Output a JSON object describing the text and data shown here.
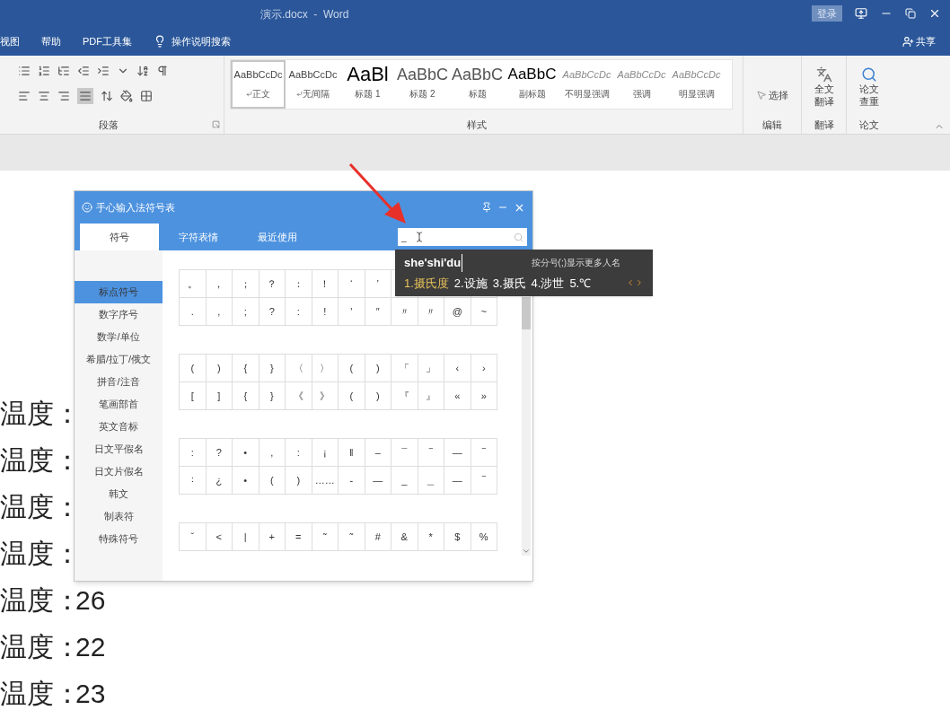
{
  "title_bar": {
    "title": "演示.docx  -  Word",
    "login": "登录"
  },
  "menu": [
    {
      "label": "视图",
      "kind": "tab"
    },
    {
      "label": "帮助",
      "kind": "tab"
    },
    {
      "label": "PDF工具集",
      "kind": "tab"
    },
    {
      "label": "操作说明搜索",
      "kind": "search"
    }
  ],
  "share": "共享",
  "ribbon": {
    "paragraph_group": "段落",
    "styles_group": "样式",
    "styles": [
      {
        "preview": "AaBbCcDc",
        "name": "正文",
        "selected": true,
        "kind": "plain"
      },
      {
        "preview": "AaBbCcDc",
        "name": "无间隔",
        "selected": false,
        "kind": "plain"
      },
      {
        "preview": "AaBl",
        "name": "标题 1",
        "selected": false,
        "kind": "heading1"
      },
      {
        "preview": "AaBbC",
        "name": "标题 2",
        "selected": false,
        "kind": "heading2"
      },
      {
        "preview": "AaBbC",
        "name": "标题",
        "selected": false,
        "kind": "heading2"
      },
      {
        "preview": "AaBbC",
        "name": "副标题",
        "selected": false,
        "kind": "subtitle"
      },
      {
        "preview": "AaBbCcDc",
        "name": "不明显强调",
        "selected": false,
        "kind": "emphasis"
      },
      {
        "preview": "AaBbCcDc",
        "name": "强调",
        "selected": false,
        "kind": "emphasis"
      },
      {
        "preview": "AaBbCcDc",
        "name": "明显强调",
        "selected": false,
        "kind": "emphasis"
      }
    ],
    "edit": {
      "select": "选择",
      "group": "编辑"
    },
    "translate": {
      "label": "全文翻译",
      "group": "翻译"
    },
    "paper": {
      "label": "论文查重",
      "group": "论文"
    }
  },
  "document": {
    "lines": [
      {
        "label": "温度："
      },
      {
        "label": "温度："
      },
      {
        "label": "温度："
      },
      {
        "label": "温度："
      },
      {
        "label": "温度：",
        "value": "26"
      },
      {
        "label": "温度：",
        "value": "22"
      },
      {
        "label": "温度：",
        "value": "23"
      }
    ]
  },
  "symbol_dialog": {
    "title": "手心输入法符号表",
    "tabs": [
      {
        "label": "符号",
        "selected": true
      },
      {
        "label": "字符表情",
        "selected": false
      },
      {
        "label": "最近使用",
        "selected": false
      }
    ],
    "search": {
      "value": "_"
    },
    "categories": [
      {
        "label": "标点符号",
        "selected": true
      },
      {
        "label": "数字序号",
        "selected": false
      },
      {
        "label": "数学/单位",
        "selected": false
      },
      {
        "label": "希腊/拉丁/俄文",
        "selected": false
      },
      {
        "label": "拼音/注音",
        "selected": false
      },
      {
        "label": "笔画部首",
        "selected": false
      },
      {
        "label": "英文音标",
        "selected": false
      },
      {
        "label": "日文平假名",
        "selected": false
      },
      {
        "label": "日文片假名",
        "selected": false
      },
      {
        "label": "韩文",
        "selected": false
      },
      {
        "label": "制表符",
        "selected": false
      },
      {
        "label": "特殊符号",
        "selected": false
      }
    ],
    "blocks": [
      [
        [
          "。",
          "，",
          "；",
          "？",
          "：",
          "！",
          "‘",
          "’"
        ],
        [
          ".",
          ",",
          ";",
          "?",
          ":",
          "!",
          "'",
          "″",
          "〃",
          "〃",
          "@",
          "~"
        ]
      ],
      [
        [
          "(",
          ")",
          "{",
          "}",
          "〈",
          "〉",
          "(",
          ")",
          "「",
          "」",
          "‹",
          "›"
        ],
        [
          "[",
          "]",
          "{",
          "}",
          "《",
          "》",
          "(",
          ")",
          "『",
          "』",
          "«",
          "»"
        ]
      ],
      [
        [
          ":",
          "?",
          "•",
          ",",
          ":",
          "¡",
          "‖",
          "–",
          "¯",
          "‾",
          "—",
          "‾"
        ],
        [
          "∶",
          "¿",
          "•",
          "(",
          ")",
          "……",
          "-",
          "—",
          "_",
          "＿",
          "—",
          "‾"
        ]
      ],
      [
        [
          "ˇ",
          "<",
          "|",
          "+",
          "=",
          "˜",
          "˜",
          "#",
          "&",
          "*",
          "$",
          "%"
        ]
      ]
    ]
  },
  "ime_popup": {
    "input": "she'shi'du",
    "hint": "按分号(;)显示更多人名",
    "candidates": [
      {
        "text": "1.摄氏度",
        "selected": true
      },
      {
        "text": "2.设施",
        "selected": false
      },
      {
        "text": "3.摄氏",
        "selected": false
      },
      {
        "text": "4.涉世",
        "selected": false
      },
      {
        "text": "5.℃",
        "selected": false
      }
    ]
  }
}
